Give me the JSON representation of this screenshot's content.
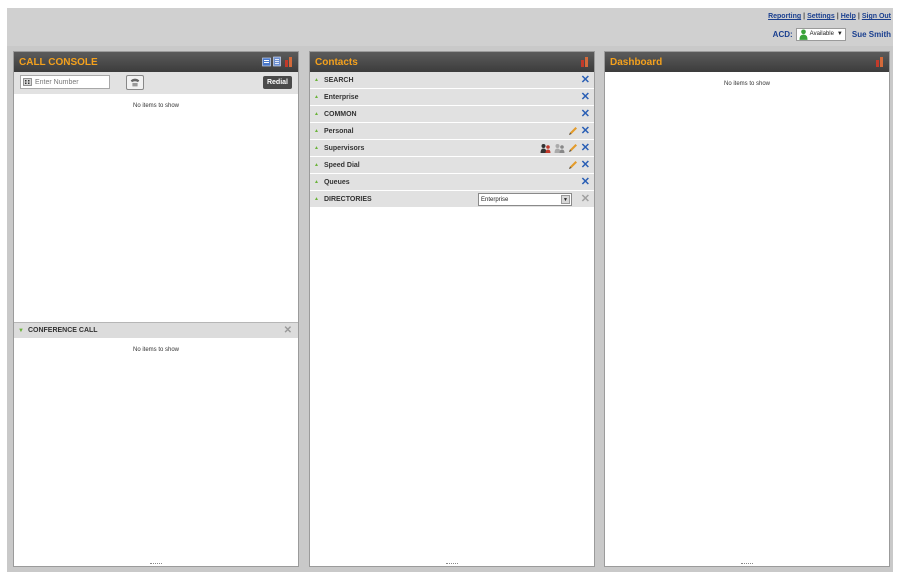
{
  "top_links": {
    "reporting": "Reporting",
    "settings": "Settings",
    "help": "Help",
    "sign_out": "Sign Out",
    "separator": "|"
  },
  "acd": {
    "label": "ACD:",
    "status": "Available",
    "status_color": "#3aa33a",
    "user_name": "Sue Smith"
  },
  "call_console": {
    "title": "CALL CONSOLE",
    "dial_placeholder": "Enter Number",
    "redial_label": "Redial",
    "empty_message": "No items to show",
    "conference": {
      "title": "CONFERENCE CALL",
      "empty_message": "No items to show"
    }
  },
  "contacts": {
    "title": "Contacts",
    "rows": [
      {
        "label": "SEARCH"
      },
      {
        "label": "Enterprise"
      },
      {
        "label": "COMMON"
      },
      {
        "label": "Personal"
      },
      {
        "label": "Supervisors"
      },
      {
        "label": "Speed Dial"
      },
      {
        "label": "Queues"
      },
      {
        "label": "DIRECTORIES"
      }
    ],
    "directory_selected": "Enterprise"
  },
  "dashboard": {
    "title": "Dashboard",
    "empty_message": "No items to show"
  },
  "colors": {
    "header_text": "#f4a11d",
    "link": "#1a3f8f",
    "close_blue": "#2a5fb5"
  }
}
